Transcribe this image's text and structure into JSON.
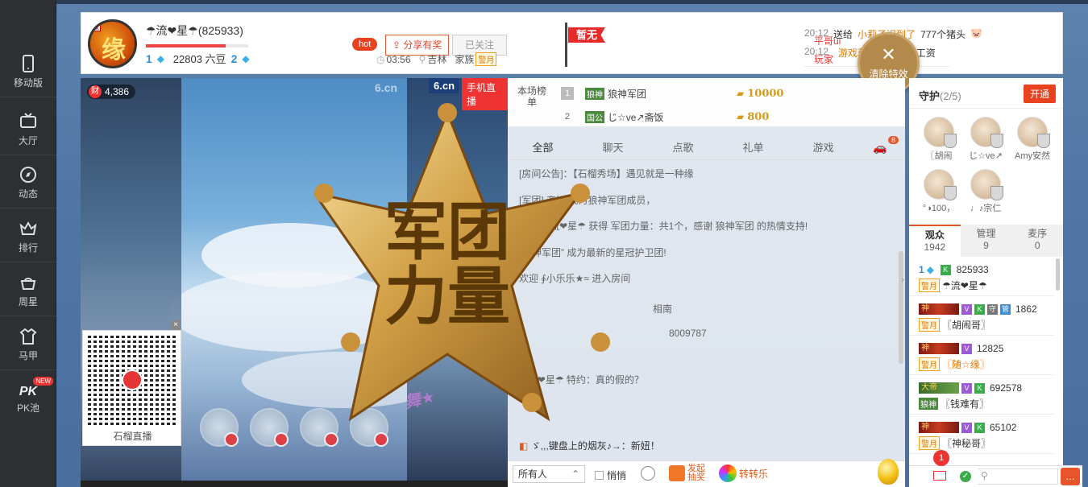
{
  "sidebar": {
    "items": [
      {
        "label": "移动版",
        "icon": "mobile-icon"
      },
      {
        "label": "大厅",
        "icon": "tv-icon"
      },
      {
        "label": "动态",
        "icon": "compass-icon"
      },
      {
        "label": "排行",
        "icon": "crown-icon"
      },
      {
        "label": "周星",
        "icon": "basket-icon"
      },
      {
        "label": "马甲",
        "icon": "shirt-icon"
      },
      {
        "label": "PK池",
        "icon": "pk-icon",
        "badge": "NEW"
      }
    ]
  },
  "header": {
    "avatar_tag": "殿",
    "avatar_glyph": "缘",
    "anchor_name": "☂流❤星☂(825933)",
    "progress": 0.78,
    "level_left": "1",
    "beans": "22803 六豆",
    "level_right": "2",
    "hot_label": "hot",
    "share_label": "分享有奖",
    "follow_label": "已关注",
    "time": "03:56",
    "location": "吉林",
    "family_label": "家族",
    "family_tag": "警月",
    "flag_label": "暂无"
  },
  "news": [
    {
      "time": "20:12",
      "user": "平哥ui",
      "verb": "送给",
      "target": "小莉子迟到了",
      "detail": "777个猪头"
    },
    {
      "time": "20:12",
      "user": "玩家",
      "verb": "",
      "target": "游戏获得",
      "detail": "1个上缴工资"
    }
  ],
  "clear_effects": {
    "label": "清除特效"
  },
  "stage": {
    "wealth": "4,386",
    "wealth_icon": "财",
    "logo": "6.cn",
    "mobile_tag": "手机直播",
    "watermark": "6.cn",
    "qr_label": "石榴直播",
    "qr_close": "×",
    "star_text_1": "军团",
    "star_text_2": "力量"
  },
  "rank": {
    "label": "本场榜单",
    "rows": [
      {
        "rank": "1",
        "group": "狼神",
        "name": "狼神军团",
        "coins": "10000"
      },
      {
        "rank": "2",
        "group": "国公",
        "name": "じ☆ve↗斋饭",
        "coins": "800"
      }
    ]
  },
  "chat_tabs": [
    "全部",
    "聊天",
    "点歌",
    "礼单",
    "游戏"
  ],
  "car_badge": "8",
  "messages": [
    {
      "text": "[房间公告]：【石榴秀场】遇见就是一种缘"
    },
    {
      "text": "[军团] 斋饭 成为狼神军团成员，"
    },
    {
      "text": "恭喜 ☂流❤星☂ 获得 军团力量：共1个，感谢 狼神军团 的热情支持!"
    },
    {
      "text": "“狼神军团” 成为最新的星冠护卫团!"
    },
    {
      "text": "欢迎 ∮小乐乐★≈ 进入房间"
    },
    {
      "text": "相南"
    },
    {
      "text": "8009787"
    },
    {
      "text": "☂流❤星☂ 特约：真的假的？"
    }
  ],
  "broadcast": "ゞ,,,键盘上的烟灰♪→：新妞！",
  "chatbar": {
    "target": "所有人",
    "whisper": "悄悄",
    "lottery_line1": "发起",
    "lottery_line2": "抽奖",
    "wheel": "转转乐"
  },
  "guard": {
    "title": "守护",
    "count": "(2/5)",
    "open": "开通",
    "members": [
      "〖胡闹",
      "じ☆ve↗",
      "Amy安然",
      "°◑100，",
      "♩♪宗仁"
    ]
  },
  "user_tabs": [
    {
      "label": "观众",
      "count": "1942"
    },
    {
      "label": "管理",
      "count": "9"
    },
    {
      "label": "麦序",
      "count": "0"
    }
  ],
  "users": [
    {
      "id": "825933",
      "name": "☂流❤星☂",
      "nob": "",
      "vip": "1",
      "tag": "警月",
      "gold": false
    },
    {
      "id": "1862",
      "name": "〖胡闹哥〗",
      "nob": "神",
      "vip": "V",
      "tag": "警月",
      "gold": false
    },
    {
      "id": "12825",
      "name": "〖随☆缘〗",
      "nob": "神",
      "vip": "V",
      "tag": "警月",
      "gold": true
    },
    {
      "id": "692578",
      "name": "〖钱难有〗",
      "nob": "大帝",
      "vip": "V",
      "tag": "狼神",
      "gold": false
    },
    {
      "id": "65102",
      "name": "〖神秘哥〗",
      "nob": "神",
      "vip": "V",
      "tag": "警月",
      "gold": false
    }
  ],
  "bottom": {
    "mail_count": "1"
  },
  "colors": {
    "accent": "#e8552d",
    "red": "#e33333",
    "gold": "#e07800"
  }
}
